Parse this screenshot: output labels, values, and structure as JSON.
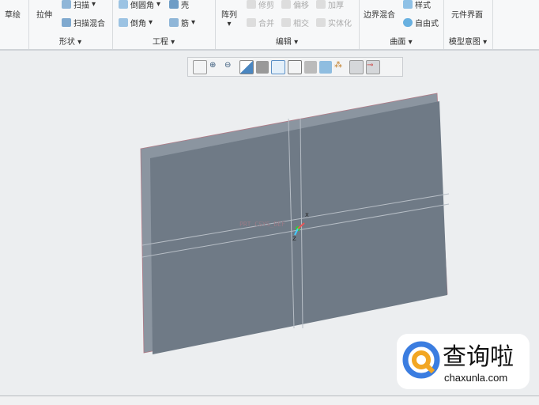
{
  "ribbon": {
    "sketch": "草绘",
    "extrude": "拉伸",
    "sweep": "扫描",
    "swept_blend": "扫描混合",
    "round": "倒圆角",
    "shell": "壳",
    "chamfer": "倒角",
    "rib": "筋",
    "pattern": "阵列",
    "trim": "修剪",
    "offset": "偏移",
    "thicken": "加厚",
    "merge": "合并",
    "intersect": "相交",
    "solidify": "实体化",
    "boundary_blend": "边界混合",
    "style": "样式",
    "freestyle": "自由式",
    "component_interface": "元件界面",
    "groups": [
      "形状",
      "工程",
      "编辑",
      "曲面",
      "模型意图"
    ]
  },
  "view_toolbar": [
    "refit",
    "zoom-in",
    "zoom-out",
    "repaint",
    "display-style",
    "saved-views",
    "view-manager",
    "perspective",
    "spin-center",
    "annotations",
    "plane-display",
    "csys-display"
  ],
  "model": {
    "csys_label": "PRT_CSYS_DEF",
    "axis_x": "X",
    "axis_z": "Z"
  },
  "watermark": {
    "text": "查询啦",
    "url": "chaxunla.com"
  }
}
